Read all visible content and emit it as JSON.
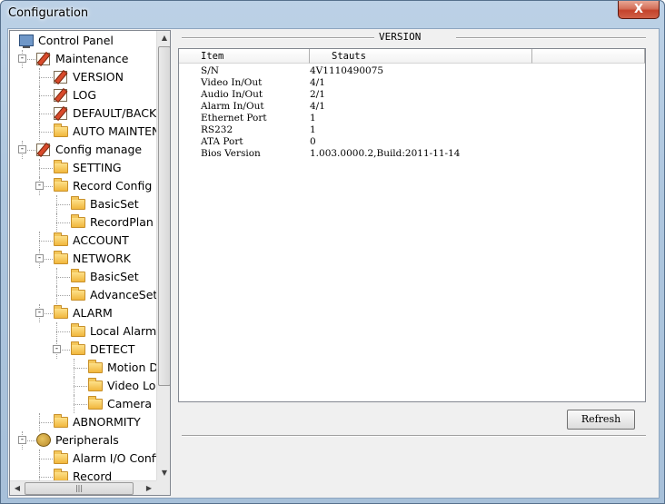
{
  "window": {
    "title": "Configuration",
    "close_label": "X"
  },
  "tree": {
    "items": [
      {
        "label": "Control Panel",
        "icon": "computer-icon",
        "level": 0,
        "expander": ""
      },
      {
        "label": "Maintenance",
        "icon": "edit-icon",
        "level": 1,
        "expander": "−"
      },
      {
        "label": "VERSION",
        "icon": "edit-icon",
        "level": 2,
        "expander": ""
      },
      {
        "label": "LOG",
        "icon": "edit-icon",
        "level": 2,
        "expander": ""
      },
      {
        "label": "DEFAULT/BACKU",
        "icon": "edit-icon",
        "level": 2,
        "expander": ""
      },
      {
        "label": "AUTO MAINTENA",
        "icon": "folder-icon",
        "level": 2,
        "expander": ""
      },
      {
        "label": "Config manage",
        "icon": "tools-icon",
        "level": 1,
        "expander": "−"
      },
      {
        "label": "SETTING",
        "icon": "folder-icon",
        "level": 2,
        "expander": ""
      },
      {
        "label": "Record Config",
        "icon": "folder-icon",
        "level": 2,
        "expander": "−"
      },
      {
        "label": "BasicSet",
        "icon": "folder-icon",
        "level": 3,
        "expander": ""
      },
      {
        "label": "RecordPlan",
        "icon": "folder-icon",
        "level": 3,
        "expander": ""
      },
      {
        "label": "ACCOUNT",
        "icon": "folder-icon",
        "level": 2,
        "expander": ""
      },
      {
        "label": "NETWORK",
        "icon": "folder-icon",
        "level": 2,
        "expander": "−"
      },
      {
        "label": "BasicSet",
        "icon": "folder-icon",
        "level": 3,
        "expander": ""
      },
      {
        "label": "AdvanceSet",
        "icon": "folder-icon",
        "level": 3,
        "expander": ""
      },
      {
        "label": "ALARM",
        "icon": "folder-icon",
        "level": 2,
        "expander": "−"
      },
      {
        "label": "Local Alarm",
        "icon": "folder-icon",
        "level": 3,
        "expander": ""
      },
      {
        "label": "DETECT",
        "icon": "folder-icon",
        "level": 3,
        "expander": "−"
      },
      {
        "label": "Motion De",
        "icon": "folder-icon",
        "level": 4,
        "expander": ""
      },
      {
        "label": "Video Loss",
        "icon": "folder-icon",
        "level": 4,
        "expander": ""
      },
      {
        "label": "Camera M",
        "icon": "folder-icon",
        "level": 4,
        "expander": ""
      },
      {
        "label": "ABNORMITY",
        "icon": "folder-icon",
        "level": 2,
        "expander": ""
      },
      {
        "label": "Peripherals",
        "icon": "plug-icon",
        "level": 1,
        "expander": "−"
      },
      {
        "label": "Alarm I/O Config",
        "icon": "folder-icon",
        "level": 2,
        "expander": ""
      },
      {
        "label": "Record",
        "icon": "folder-icon",
        "level": 2,
        "expander": ""
      }
    ]
  },
  "version": {
    "group_title": "VERSION",
    "columns": [
      "Item",
      "Stauts"
    ],
    "rows": [
      [
        "S/N",
        "4V1110490075"
      ],
      [
        "Video In/Out",
        "4/1"
      ],
      [
        "Audio In/Out",
        "2/1"
      ],
      [
        "Alarm In/Out",
        "4/1"
      ],
      [
        "Ethernet Port",
        "1"
      ],
      [
        "RS232",
        "1"
      ],
      [
        "ATA Port",
        "0"
      ],
      [
        "Bios Version",
        "1.003.0000.2,Build:2011-11-14"
      ]
    ],
    "refresh_label": "Refresh"
  }
}
